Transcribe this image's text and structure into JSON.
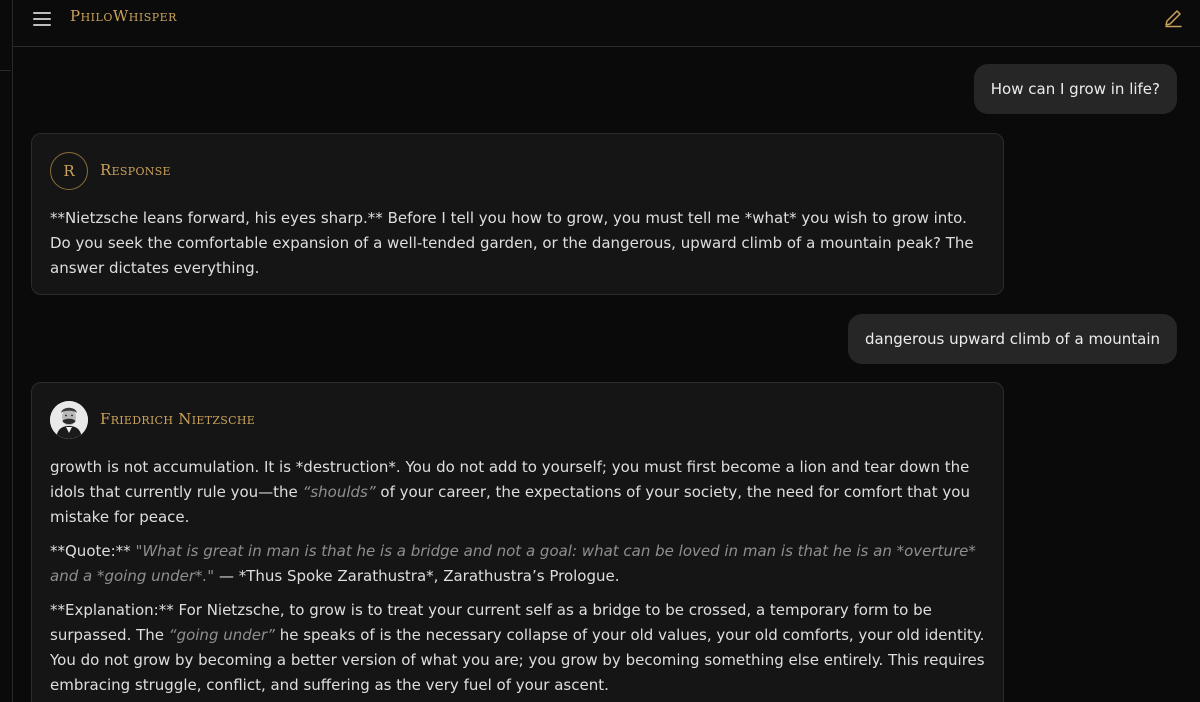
{
  "app": {
    "title": "PhiloWhisper"
  },
  "icons": {
    "menu": "hamburger-menu-icon",
    "edit": "pencil-edit-icon"
  },
  "colors": {
    "accent_gold": "#c9a15a",
    "background": "#0a0a0a",
    "card": "#151515",
    "user_bubble": "#262626"
  },
  "messages": {
    "user_1": "How can I grow in life?",
    "response_1": {
      "avatar_letter": "R",
      "speaker": "Response",
      "text": "**Nietzsche leans forward, his eyes sharp.** Before I tell you how to grow, you must tell me *what* you wish to grow into. Do you seek the comfortable expansion of a well-tended garden, or the dangerous, upward climb of a mountain peak? The answer dictates everything."
    },
    "user_2": "dangerous upward climb of a mountain",
    "response_2": {
      "speaker": "Friedrich Nietzsche",
      "p1": {
        "a": "growth is not accumulation. It is *destruction*. You do not add to yourself; you must first become a lion and tear down the idols that currently rule you—the ",
        "q": "“shoulds”",
        "b": " of your career, the expectations of your society, the need for comfort that you mistake for peace."
      },
      "p2": {
        "a": "**Quote:** ",
        "q": "\"What is great in man is that he is a bridge and not a goal: what can be loved in man is that he is an *overture* and a *going under*.\"",
        "b": " — *Thus Spoke Zarathustra*, Zarathustra’s Prologue."
      },
      "p3": {
        "a": "**Explanation:** For Nietzsche, to grow is to treat your current self as a bridge to be crossed, a temporary form to be surpassed. The ",
        "q": "“going under”",
        "b": " he speaks of is the necessary collapse of your old values, your old comforts, your old identity. You do not grow by becoming a better version of what you are; you grow by becoming something else entirely. This requires embracing struggle, conflict, and suffering as the very fuel of your ascent."
      }
    }
  }
}
